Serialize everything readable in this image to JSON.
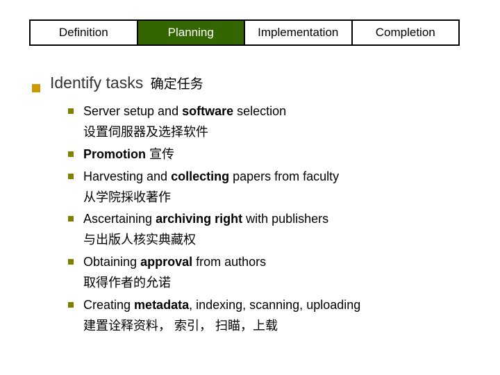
{
  "tabs": {
    "definition": "Definition",
    "planning": "Planning",
    "implementation": "Implementation",
    "completion": "Completion"
  },
  "section": {
    "title": "Identify tasks",
    "subtitle_zh": "确定任务"
  },
  "items": [
    {
      "en_pre": "Server setup and ",
      "en_bold": "software",
      "en_post": " selection",
      "zh": "设置伺服器及选择软件"
    },
    {
      "en_pre": "",
      "en_bold": "Promotion",
      "en_post": " 宣传",
      "zh": ""
    },
    {
      "en_pre": "Harvesting and ",
      "en_bold": "collecting",
      "en_post": " papers from faculty",
      "zh": "从学院採收著作"
    },
    {
      "en_pre": "Ascertaining ",
      "en_bold": "archiving right",
      "en_post": " with publishers",
      "zh": "与出版人核实典藏权"
    },
    {
      "en_pre": "Obtaining ",
      "en_bold": "approval",
      "en_post": " from authors",
      "zh": "取得作者的允诺"
    },
    {
      "en_pre": "Creating ",
      "en_bold": "metadata",
      "en_post": ", indexing, scanning, uploading",
      "zh": "建置诠释资料， 索引， 扫瞄，上载"
    }
  ]
}
